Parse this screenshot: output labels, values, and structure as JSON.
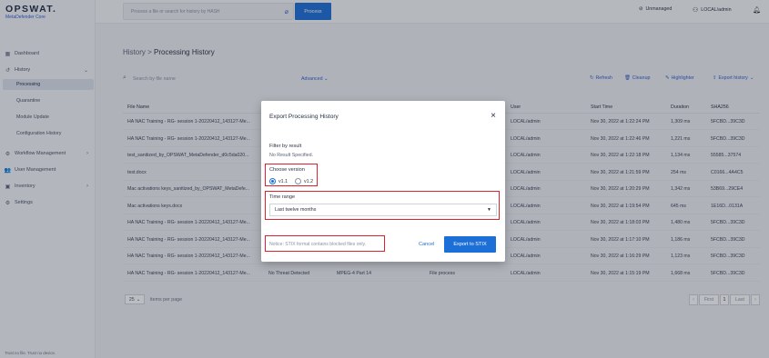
{
  "brand": {
    "name": "OPSWAT.",
    "product": "MetaDefender Core"
  },
  "topbar": {
    "search_placeholder": "Process a file or search for history by HASH",
    "process_label": "Process",
    "unmanaged_label": "Unmanaged",
    "user_label": "LOCAL/admin"
  },
  "sidebar": {
    "dashboard": "Dashboard",
    "history": "History",
    "processing": "Processing",
    "quarantine": "Quarantine",
    "module_update": "Module Update",
    "configuration_history": "Configuration History",
    "workflow_management": "Workflow Management",
    "user_management": "User Management",
    "inventory": "Inventory",
    "settings": "Settings",
    "footer": "Trust no file. Trust no device."
  },
  "breadcrumb": {
    "parent": "History",
    "separator": ">",
    "current": "Processing History"
  },
  "toolbar": {
    "search_placeholder": "Search by file name",
    "advanced": "Advanced",
    "refresh": "Refresh",
    "cleanup": "Cleanup",
    "highlighter": "Highlighter",
    "export": "Export history"
  },
  "table": {
    "headers": {
      "file_name": "File Name",
      "user": "User",
      "start_time": "Start Time",
      "duration": "Duration",
      "sha256": "SHA256"
    },
    "rows": [
      {
        "file": "HA NAC Training - RG- session 1-20220412_143127-Me...",
        "result": "",
        "type": "",
        "profile": "",
        "user": "LOCAL/admin",
        "start": "Nov 30, 2022 at 1:22:24 PM",
        "duration": "1,309 ms",
        "sha": "5FCBD...39C3D"
      },
      {
        "file": "HA NAC Training - RG- session 1-20220412_143127-Me...",
        "result": "",
        "type": "",
        "profile": "",
        "user": "LOCAL/admin",
        "start": "Nov 30, 2022 at 1:22:46 PM",
        "duration": "1,221 ms",
        "sha": "5FCBD...39C3D"
      },
      {
        "file": "test_sanitized_by_OPSWAT_MetaDefender_d0c5da020...",
        "result": "",
        "type": "",
        "profile": "",
        "user": "LOCAL/admin",
        "start": "Nov 30, 2022 at 1:22:18 PM",
        "duration": "1,134 ms",
        "sha": "55585...37574"
      },
      {
        "file": "test.docx",
        "result": "",
        "type": "",
        "profile": "",
        "user": "LOCAL/admin",
        "start": "Nov 30, 2022 at 1:21:59 PM",
        "duration": "254 ms",
        "sha": "C0166...4A4C5"
      },
      {
        "file": "Mac activations keys_sanitized_by_OPSWAT_MetaDefe...",
        "result": "",
        "type": "",
        "profile": "",
        "user": "LOCAL/admin",
        "start": "Nov 30, 2022 at 1:20:29 PM",
        "duration": "1,342 ms",
        "sha": "53B69...29CE4"
      },
      {
        "file": "Mac activations keys.docx",
        "result": "",
        "type": "",
        "profile": "",
        "user": "LOCAL/admin",
        "start": "Nov 30, 2022 at 1:19:54 PM",
        "duration": "645 ms",
        "sha": "1E16D...0131A"
      },
      {
        "file": "HA NAC Training - RG- session 1-20220412_143127-Me...",
        "result": "",
        "type": "",
        "profile": "",
        "user": "LOCAL/admin",
        "start": "Nov 30, 2022 at 1:18:03 PM",
        "duration": "1,480 ms",
        "sha": "5FCBD...39C3D"
      },
      {
        "file": "HA NAC Training - RG- session 1-20220412_143127-Me...",
        "result": "",
        "type": "",
        "profile": "",
        "user": "LOCAL/admin",
        "start": "Nov 30, 2022 at 1:17:10 PM",
        "duration": "1,186 ms",
        "sha": "5FCBD...39C3D"
      },
      {
        "file": "HA NAC Training - RG- session 1-20220412_143127-Me...",
        "result": "",
        "type": "",
        "profile": "",
        "user": "LOCAL/admin",
        "start": "Nov 30, 2022 at 1:16:29 PM",
        "duration": "1,123 ms",
        "sha": "5FCBD...39C3D"
      },
      {
        "file": "HA NAC Training - RG- session 1-20220412_143127-Me...",
        "result": "No Threat Detected",
        "type": "MPEG-4 Part 14",
        "profile": "File process",
        "user": "LOCAL/admin",
        "start": "Nov 30, 2022 at 1:15:19 PM",
        "duration": "1,668 ms",
        "sha": "5FCBD...39C3D"
      }
    ]
  },
  "pager": {
    "per_page": "25",
    "per_page_label": "items per page",
    "first": "First",
    "page": "1",
    "last": "Last"
  },
  "modal": {
    "title": "Export Processing History",
    "close": "×",
    "filter_label": "Filter by result",
    "filter_value": "No Result Specified.",
    "version_label": "Choose version",
    "version_v11": "v1.1",
    "version_v12": "v1.2",
    "selected_version": "v1.1",
    "time_label": "Time range",
    "time_value": "Last twelve months",
    "notice": "Notice: STIX format contains blocked files only.",
    "cancel": "Cancel",
    "export": "Export to STIX"
  },
  "colors": {
    "accent": "#1d6fd8",
    "highlight": "#e0202a"
  }
}
